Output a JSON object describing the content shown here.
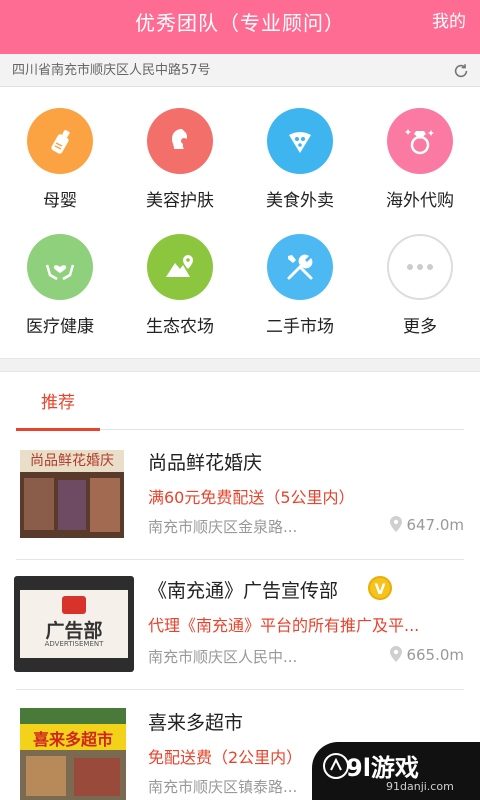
{
  "header": {
    "title": "优秀团队（专业顾问）",
    "mine": "我的"
  },
  "address": {
    "text": "四川省南充市顺庆区人民中路57号",
    "icon": "refresh-icon"
  },
  "categories": [
    {
      "label": "母婴",
      "color": "#fba343",
      "icon": "baby-bottle-icon"
    },
    {
      "label": "美容护肤",
      "color": "#f26f6a",
      "icon": "woman-face-icon"
    },
    {
      "label": "美食外卖",
      "color": "#3fb5f0",
      "icon": "pizza-slice-icon"
    },
    {
      "label": "海外代购",
      "color": "#fb7aa3",
      "icon": "diamond-ring-icon"
    },
    {
      "label": "医疗健康",
      "color": "#8fd07d",
      "icon": "heart-hands-icon"
    },
    {
      "label": "生态农场",
      "color": "#8cc63f",
      "icon": "mountain-pin-icon"
    },
    {
      "label": "二手市场",
      "color": "#4db9f3",
      "icon": "tools-icon"
    },
    {
      "label": "更多",
      "color": "#ffffff",
      "icon": "more-dots-icon"
    }
  ],
  "tabs": [
    {
      "label": "推荐",
      "active": true
    }
  ],
  "listings": [
    {
      "name": "尚品鲜花婚庆",
      "promo": "满60元免费配送（5公里内）",
      "address": "南充市顺庆区金泉路...",
      "distance": "647.0m",
      "thumb_text": "尚品鲜花婚庆"
    },
    {
      "name": "《南充通》广告宣传部",
      "promo": "代理《南充通》平台的所有推广及平...",
      "address": "南充市顺庆区人民中...",
      "distance": "665.0m",
      "verified": "V",
      "thumb_text": "广告部",
      "thumb_sub": "ADVERTISEMENT"
    },
    {
      "name": "喜来多超市",
      "promo": "免配送费（2公里内）",
      "address": "南充市顺庆区镇泰路...",
      "distance": "",
      "thumb_text": "喜来多超市"
    }
  ],
  "watermark": {
    "brand": "9l游戏",
    "site": "91danji.com"
  }
}
